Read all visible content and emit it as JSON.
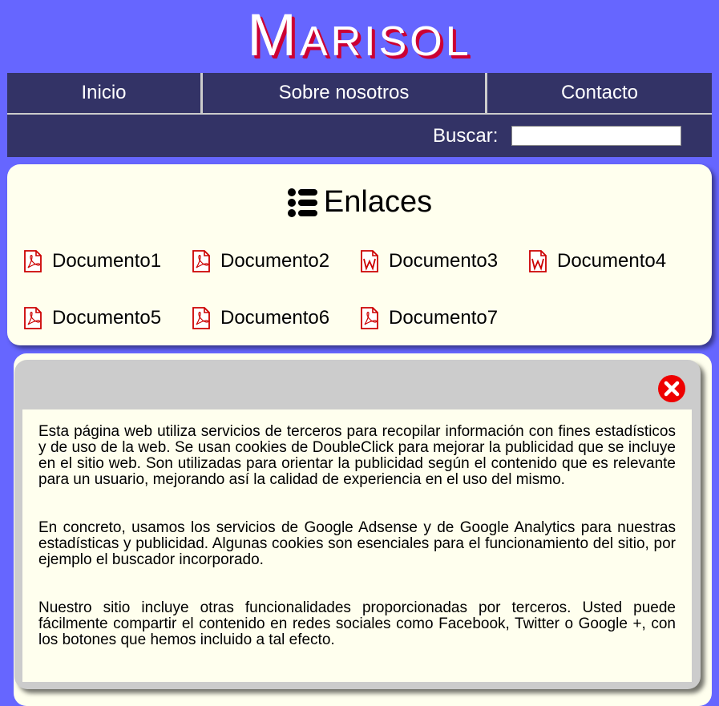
{
  "site": {
    "title": "Marisol"
  },
  "nav": {
    "items": [
      {
        "label": "Inicio"
      },
      {
        "label": "Sobre nosotros"
      },
      {
        "label": "Contacto"
      }
    ]
  },
  "search": {
    "label": "Buscar:",
    "value": ""
  },
  "links": {
    "heading": "Enlaces",
    "heading_icon": "list-icon",
    "documents": [
      {
        "label": "Documento1",
        "icon": "pdf-file-icon"
      },
      {
        "label": "Documento2",
        "icon": "pdf-file-icon"
      },
      {
        "label": "Documento3",
        "icon": "word-file-icon"
      },
      {
        "label": "Documento4",
        "icon": "word-file-icon"
      },
      {
        "label": "Documento5",
        "icon": "pdf-file-icon"
      },
      {
        "label": "Documento6",
        "icon": "pdf-file-icon"
      },
      {
        "label": "Documento7",
        "icon": "pdf-file-icon"
      }
    ]
  },
  "cookie_modal": {
    "close_icon": "close-icon",
    "paragraphs": [
      "Esta página web utiliza servicios de terceros para recopilar información con fines estadísticos y de uso de la web. Se usan cookies de DoubleClick para mejorar la publicidad que se incluye en el sitio web. Son utilizadas para orientar la publicidad según el contenido que es relevante para un usuario, mejorando así la calidad de experiencia en el uso del mismo.",
      "En concreto, usamos los servicios de Google Adsense y de Google Analytics para nuestras estadísticas y publicidad. Algunas cookies son esenciales para el funcionamiento del sitio, por ejemplo el buscador incorporado.",
      "Nuestro sitio incluye otras funcionalidades proporcionadas por terceros. Usted puede fácilmente compartir el contenido en redes sociales como Facebook, Twitter o Google +, con los botones que hemos incluido a tal efecto."
    ]
  },
  "colors": {
    "background": "#6666ff",
    "nav_background": "#333366",
    "card_background": "#ffffee",
    "title_shadow": "#cc0033",
    "icon_red": "#cc0000",
    "modal_frame": "#cccccc"
  }
}
